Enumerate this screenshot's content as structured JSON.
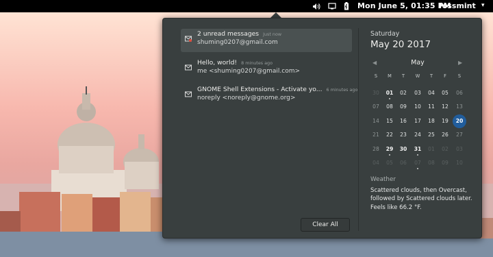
{
  "topbar": {
    "clock": "Mon June  5, 01:35 PM",
    "user": "fossmint",
    "icons": [
      "volume-icon",
      "display-icon",
      "battery-icon"
    ]
  },
  "notifications": {
    "items": [
      {
        "title": "2 unread messages",
        "time": "Just now",
        "sender": "shuming0207@gmail.com",
        "icon": "mail-unread-icon",
        "active": true
      },
      {
        "title": "Hello, world!",
        "time": "8 minutes ago",
        "sender": "me <shuming0207@gmail.com>",
        "icon": "mail-icon",
        "active": false
      },
      {
        "title": "GNOME Shell Extensions - Activate yo...",
        "time": "6 minutes ago",
        "sender": "noreply <noreply@gnome.org>",
        "icon": "mail-icon",
        "active": false
      }
    ],
    "clear_label": "Clear All"
  },
  "calendar": {
    "weekday": "Saturday",
    "date": "May 20 2017",
    "month": "May",
    "prev_icon": "chevron-left-icon",
    "next_icon": "chevron-right-icon",
    "dow": [
      "S",
      "M",
      "T",
      "W",
      "T",
      "F",
      "S"
    ],
    "today": "20",
    "weeks": [
      [
        "30",
        "01",
        "02",
        "03",
        "04",
        "05",
        "06"
      ],
      [
        "07",
        "08",
        "09",
        "10",
        "11",
        "12",
        "13"
      ],
      [
        "14",
        "15",
        "16",
        "17",
        "18",
        "19",
        "20"
      ],
      [
        "21",
        "22",
        "23",
        "24",
        "25",
        "26",
        "27"
      ],
      [
        "28",
        "29",
        "30",
        "31",
        "01",
        "02",
        "03"
      ],
      [
        "04",
        "05",
        "06",
        "07",
        "08",
        "09",
        "10"
      ]
    ]
  },
  "weather": {
    "title": "Weather",
    "description": "Scattered clouds, then Overcast, followed by Scattered clouds later. Feels like 66.2 °F."
  },
  "colors": {
    "panel": "#393f3f",
    "accent": "#215d9c",
    "topbar": "#000000"
  }
}
